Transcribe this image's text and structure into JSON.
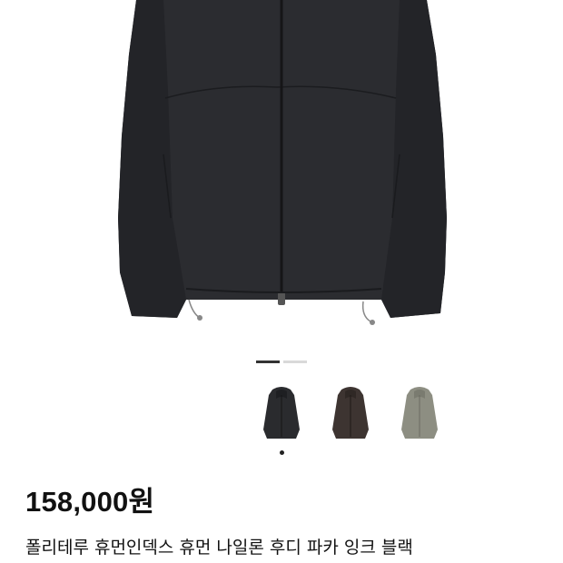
{
  "product": {
    "price": "158,000원",
    "name": "폴리테루 휴먼인덱스 휴먼 나일론 후디 파카 잉크 블랙"
  },
  "gallery": {
    "image_count": 2,
    "active_index": 0
  },
  "color_options": [
    {
      "name": "black-swatch",
      "color": "#2a2b2e",
      "selected": true
    },
    {
      "name": "brown-swatch",
      "color": "#3d3431",
      "selected": false
    },
    {
      "name": "khaki-swatch",
      "color": "#8d8e82",
      "selected": false
    }
  ]
}
